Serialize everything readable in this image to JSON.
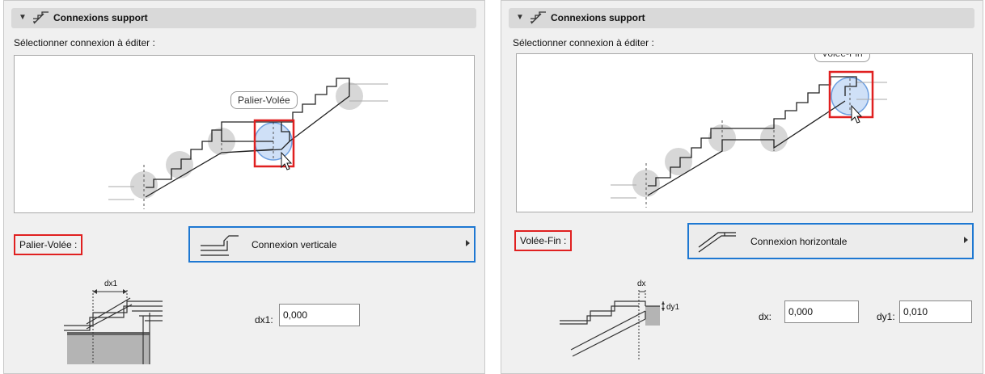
{
  "left_panel": {
    "header_title": "Connexions support",
    "select_label": "Sélectionner connexion à éditer :",
    "tooltip": "Palier-Volée",
    "connection_label": "Palier-Volée :",
    "connection_type": "Connexion verticale",
    "diagram_label": "dx1",
    "params": [
      {
        "label": "dx1:",
        "value": "0,000"
      }
    ]
  },
  "right_panel": {
    "header_title": "Connexions support",
    "select_label": "Sélectionner connexion à éditer :",
    "tooltip": "Volée-Fin",
    "connection_label": "Volée-Fin :",
    "connection_type": "Connexion horizontale",
    "diagram_labels": {
      "dx": "dx",
      "dy1": "dy1"
    },
    "params": [
      {
        "label": "dx:",
        "value": "0,000"
      },
      {
        "label": "dy1:",
        "value": "0,010"
      }
    ]
  },
  "colors": {
    "highlight_red": "#e02020",
    "accent_blue": "#1e78d2",
    "selection_fill": "#cfe0f7",
    "connection_dot": "#d7d7d7"
  }
}
